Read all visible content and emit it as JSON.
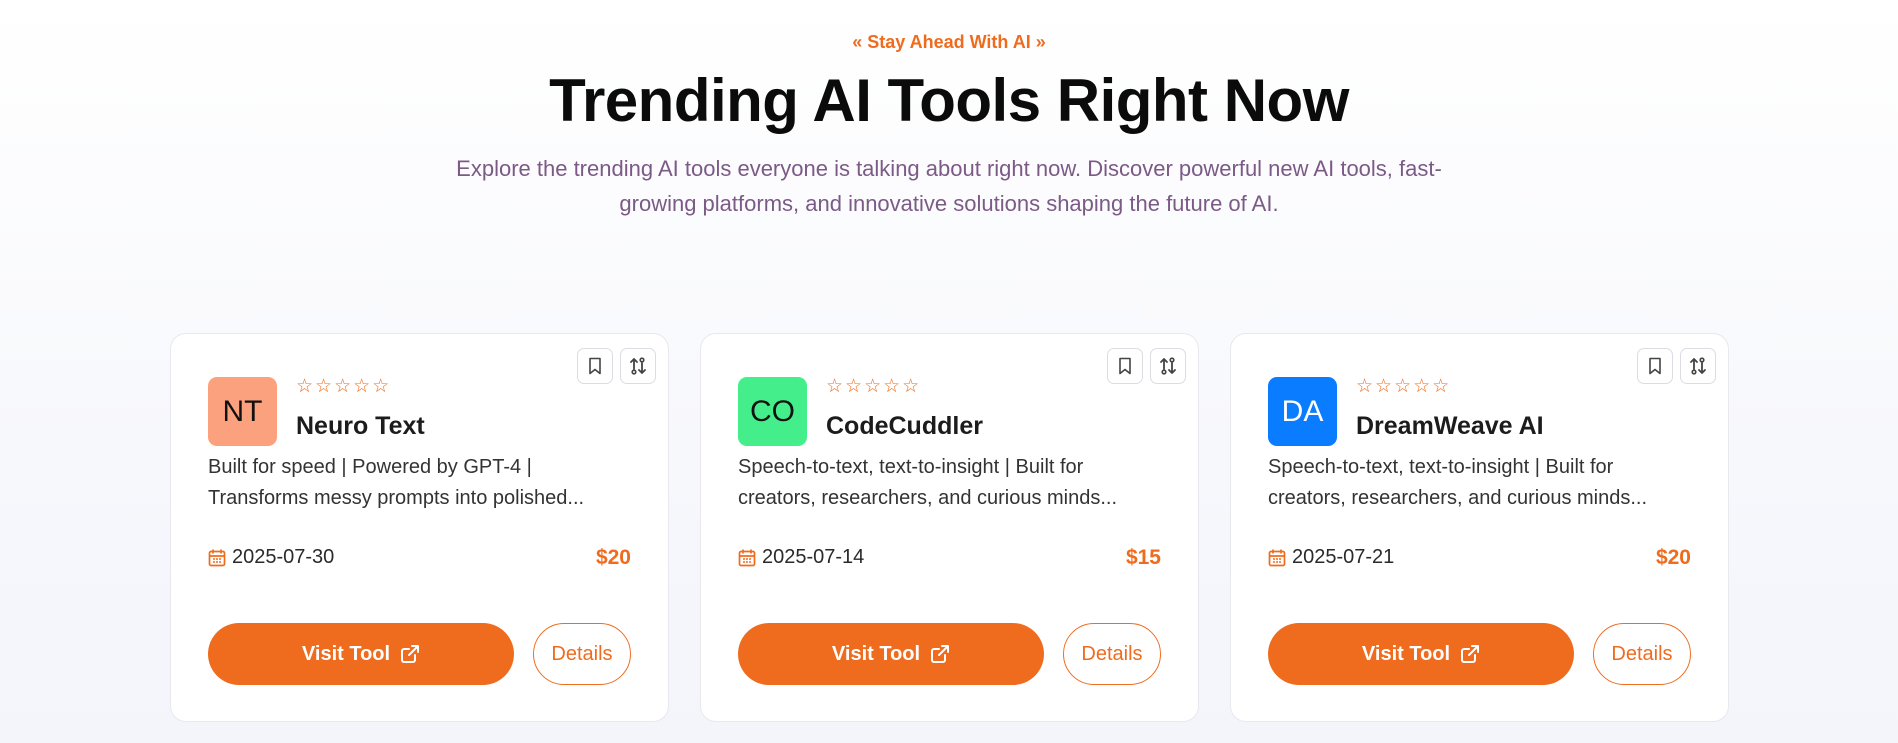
{
  "header": {
    "eyebrow": "« Stay Ahead With AI »",
    "title": "Trending AI Tools Right Now",
    "subtitle": "Explore the trending AI tools everyone is talking about right now. Discover powerful new AI tools, fast-growing platforms, and innovative solutions shaping the future of AI."
  },
  "colors": {
    "accent": "#ef6c1e"
  },
  "cards": [
    {
      "initials": "NT",
      "avatar_color": "#fca17d",
      "initials_color": "#111111",
      "stars": "☆☆☆☆☆",
      "name": "Neuro Text",
      "description": "Built for speed | Powered by GPT-4 | Transforms messy prompts into polished...",
      "date": "2025-07-30",
      "price": "$20",
      "visit_label": "Visit Tool",
      "details_label": "Details"
    },
    {
      "initials": "CO",
      "avatar_color": "#44ee8b",
      "initials_color": "#111111",
      "stars": "☆☆☆☆☆",
      "name": "CodeCuddler",
      "description": "Speech-to-text, text-to-insight | Built for creators, researchers, and curious minds...",
      "date": "2025-07-14",
      "price": "$15",
      "visit_label": "Visit Tool",
      "details_label": "Details"
    },
    {
      "initials": "DA",
      "avatar_color": "#0a7cff",
      "initials_color": "#ffffff",
      "stars": "☆☆☆☆☆",
      "name": "DreamWeave AI",
      "description": "Speech-to-text, text-to-insight | Built for creators, researchers, and curious minds...",
      "date": "2025-07-21",
      "price": "$20",
      "visit_label": "Visit Tool",
      "details_label": "Details"
    }
  ]
}
